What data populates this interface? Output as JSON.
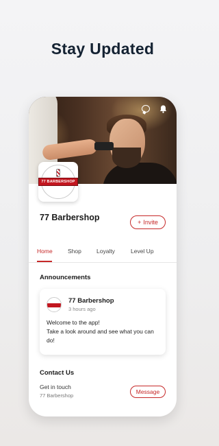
{
  "headline": "Stay Updated",
  "app": {
    "business_name": "77 Barbershop",
    "logo_text": "77 BARBERSHOP",
    "invite_label": "Invite",
    "invite_icon": "plus-icon",
    "top_icons": [
      "chat-icon",
      "bell-icon"
    ]
  },
  "tabs": [
    {
      "label": "Home",
      "active": true
    },
    {
      "label": "Shop",
      "active": false
    },
    {
      "label": "Loyalty",
      "active": false
    },
    {
      "label": "Level Up",
      "active": false
    }
  ],
  "announcements": {
    "title": "Announcements",
    "post": {
      "author": "77 Barbershop",
      "time": "3 hours ago",
      "body_line1": "Welcome to the app!",
      "body_line2": "Take a look around and see what you can do!"
    }
  },
  "contact": {
    "title": "Contact Us",
    "label": "Get in touch",
    "sub": "77 Barbershop",
    "button": "Message"
  },
  "colors": {
    "accent": "#c62828",
    "headline": "#142232"
  }
}
